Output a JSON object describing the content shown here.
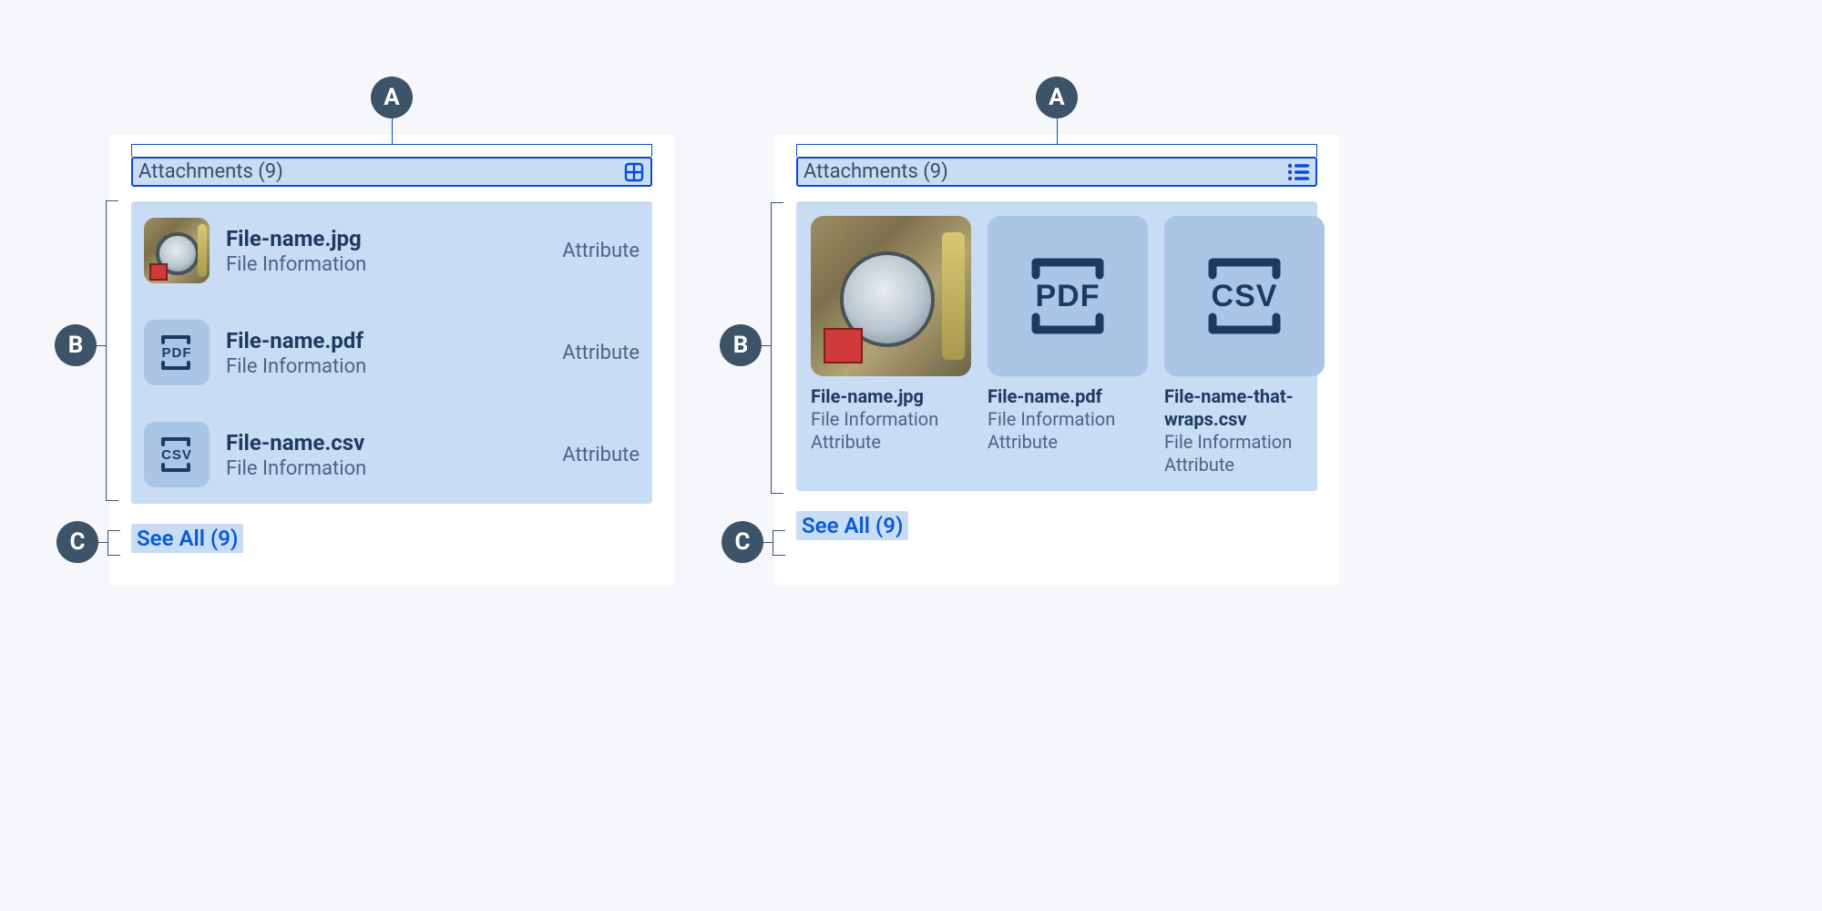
{
  "annotations": {
    "a": "A",
    "b": "B",
    "c": "C"
  },
  "left": {
    "header": {
      "title": "Attachments (9)",
      "toggle_icon": "grid"
    },
    "items": [
      {
        "name": "File-name.jpg",
        "info": "File Information",
        "attr": "Attribute",
        "type": "image"
      },
      {
        "name": "File-name.pdf",
        "info": "File Information",
        "attr": "Attribute",
        "type": "pdf"
      },
      {
        "name": "File-name.csv",
        "info": "File Information",
        "attr": "Attribute",
        "type": "csv"
      }
    ],
    "see_all": "See All (9)"
  },
  "right": {
    "header": {
      "title": "Attachments (9)",
      "toggle_icon": "list"
    },
    "items": [
      {
        "name": "File-name.jpg",
        "info": "File Information",
        "attr": "Attribute",
        "type": "image"
      },
      {
        "name": "File-name.pdf",
        "info": "File Information",
        "attr": "Attribute",
        "type": "pdf"
      },
      {
        "name": "File-name-that-wraps.csv",
        "info": "File Information",
        "attr": "Attribute",
        "type": "csv"
      }
    ],
    "see_all": "See All (9)"
  },
  "filetype_glyphs": {
    "pdf": "PDF",
    "csv": "CSV"
  }
}
